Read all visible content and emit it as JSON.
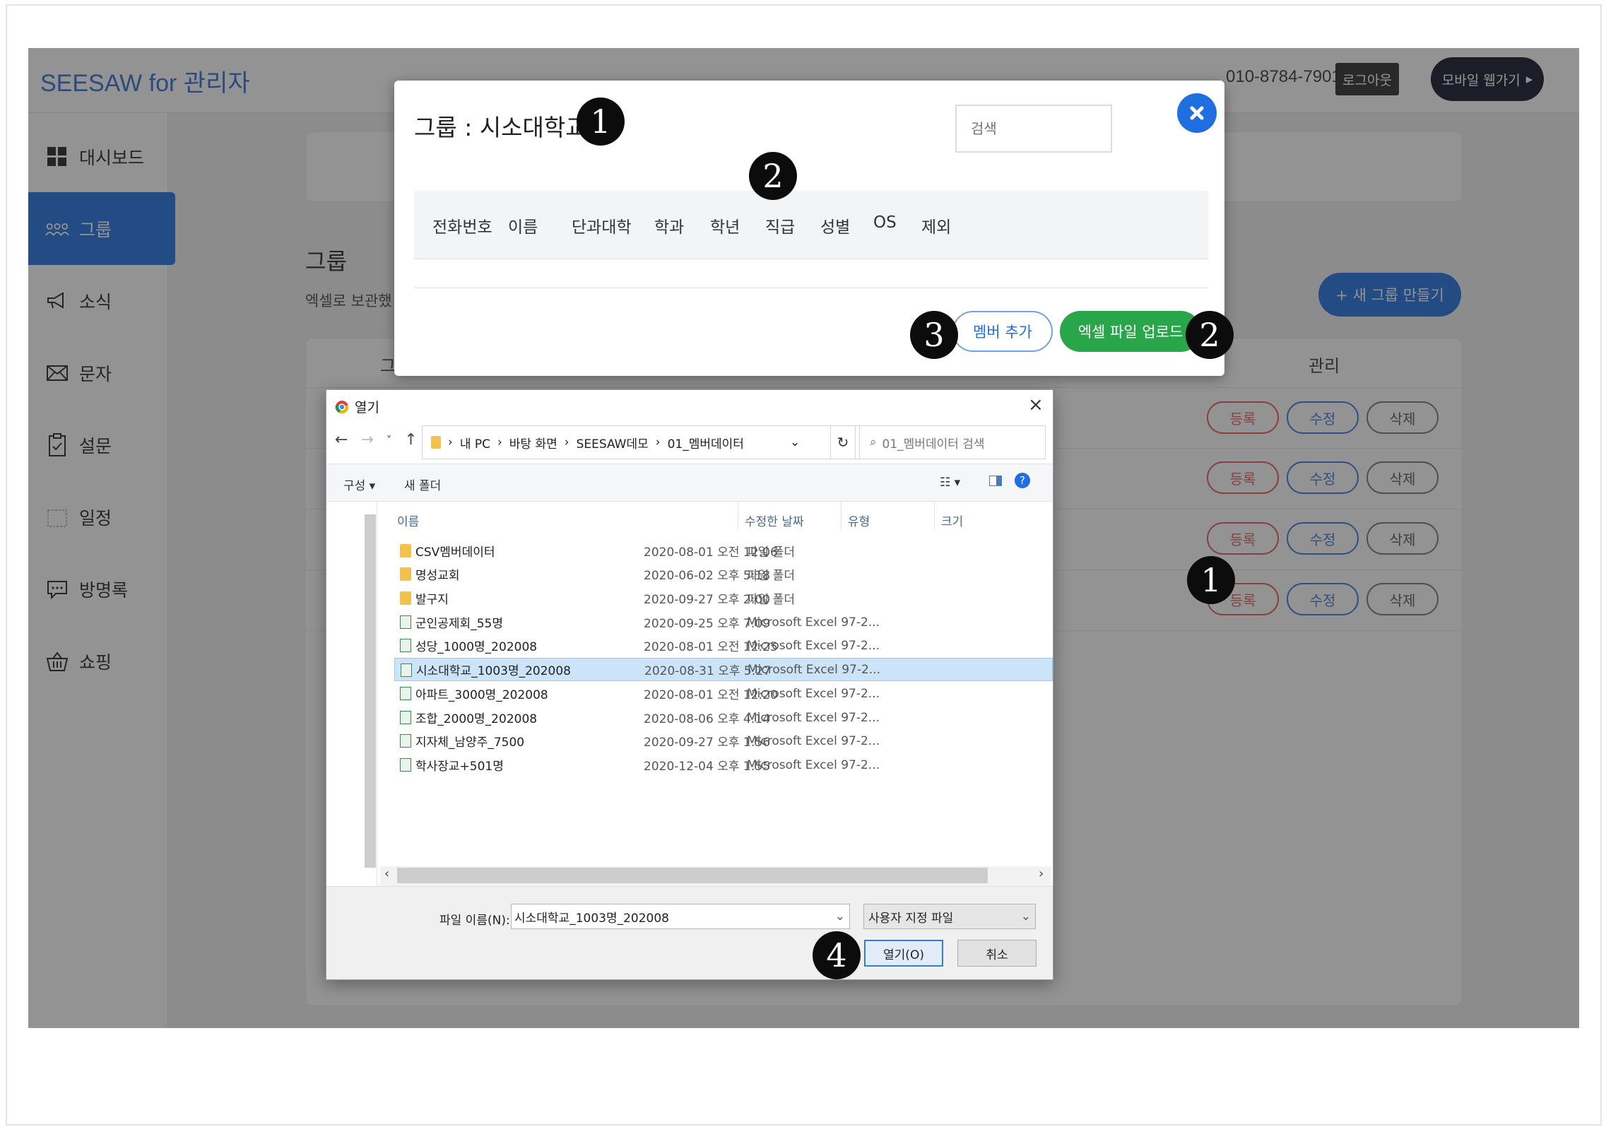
{
  "app": {
    "brand": "SEESAW for 관리자",
    "phone": "010-8784-7901",
    "logout_label": "로그아웃",
    "mobile_label": "모바일 웹가기"
  },
  "sidebar": {
    "items": [
      {
        "label": "대시보드",
        "icon": "dashboard-icon"
      },
      {
        "label": "그룹",
        "icon": "group-icon"
      },
      {
        "label": "소식",
        "icon": "megaphone-icon"
      },
      {
        "label": "문자",
        "icon": "envelope-icon"
      },
      {
        "label": "설문",
        "icon": "survey-icon"
      },
      {
        "label": "일정",
        "icon": "calendar-icon"
      },
      {
        "label": "방명록",
        "icon": "chat-icon"
      },
      {
        "label": "쇼핑",
        "icon": "basket-icon"
      }
    ]
  },
  "background_page": {
    "title": "그룹",
    "subtitle": "엑셀로 보관했",
    "new_group_label": "+ 새 그룹 만들기",
    "col_group": "그",
    "col_manage": "관리",
    "row_buttons": {
      "register": "등록",
      "edit": "수정",
      "delete": "삭제"
    }
  },
  "group_modal": {
    "title": "그룹 : 시소대학교",
    "search_placeholder": "검색",
    "columns": [
      "전화번호",
      "이름",
      "단과대학",
      "학과",
      "학년",
      "직급",
      "성별",
      "OS",
      "제외"
    ],
    "member_add_label": "멤버 추가",
    "excel_upload_label": "엑셀 파일 업로드"
  },
  "callouts": {
    "one": "1",
    "two": "2",
    "three": "3",
    "four": "4"
  },
  "file_dialog": {
    "title": "열기",
    "path": [
      "내 PC",
      "바탕 화면",
      "SEESAW데모",
      "01_멤버데이터"
    ],
    "search_placeholder": "01_멤버데이터 검색",
    "organize_label": "구성",
    "new_folder_label": "새 폴더",
    "columns": {
      "name": "이름",
      "date": "수정한 날짜",
      "type": "유형",
      "size": "크기"
    },
    "files": [
      {
        "name": "CSV멤버데이터",
        "date": "2020-08-01 오전 12:06",
        "type": "파일 폴더",
        "kind": "folder"
      },
      {
        "name": "명성교회",
        "date": "2020-06-02 오후 5:18",
        "type": "파일 폴더",
        "kind": "folder"
      },
      {
        "name": "발구지",
        "date": "2020-09-27 오후 2:00",
        "type": "파일 폴더",
        "kind": "folder"
      },
      {
        "name": "군인공제회_55명",
        "date": "2020-09-25 오후 7:09",
        "type": "Microsoft Excel 97-2...",
        "kind": "excel"
      },
      {
        "name": "성당_1000명_202008",
        "date": "2020-08-01 오전 12:25",
        "type": "Microsoft Excel 97-2...",
        "kind": "excel"
      },
      {
        "name": "시소대학교_1003명_202008",
        "date": "2020-08-31 오후 5:27",
        "type": "Microsoft Excel 97-2...",
        "kind": "excel",
        "selected": true
      },
      {
        "name": "아파트_3000명_202008",
        "date": "2020-08-01 오전 12:20",
        "type": "Microsoft Excel 97-2...",
        "kind": "excel"
      },
      {
        "name": "조합_2000명_202008",
        "date": "2020-08-06 오후 4:14",
        "type": "Microsoft Excel 97-2...",
        "kind": "excel"
      },
      {
        "name": "지자체_남양주_7500",
        "date": "2020-09-27 오후 1:56",
        "type": "Microsoft Excel 97-2...",
        "kind": "excel"
      },
      {
        "name": "학사장교+501명",
        "date": "2020-12-04 오후 1:55",
        "type": "Microsoft Excel 97-2...",
        "kind": "excel"
      }
    ],
    "filename_label": "파일 이름(N):",
    "filename_value": "시소대학교_1003명_202008",
    "filetype_value": "사용자 지정 파일",
    "open_label": "열기(O)",
    "cancel_label": "취소"
  }
}
